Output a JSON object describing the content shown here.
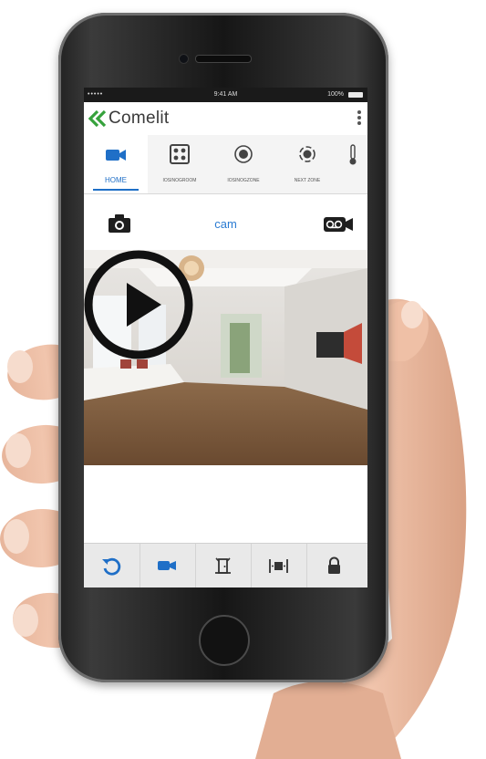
{
  "status_bar": {
    "signal": "•••••",
    "time": "9:41 AM",
    "battery": "100%"
  },
  "app": {
    "brand": "Comelit"
  },
  "tabs": [
    {
      "label": "HOME",
      "icon": "camera-icon",
      "active": true
    },
    {
      "label": "IOSINOGROOM",
      "icon": "grid-icon",
      "active": false
    },
    {
      "label": "IOSINOGZONE",
      "icon": "target-icon",
      "active": false
    },
    {
      "label": "NEXT ZONE",
      "icon": "crosshair-icon",
      "active": false
    },
    {
      "label": "",
      "icon": "thermometer-icon",
      "active": false
    }
  ],
  "camera": {
    "name": "cam",
    "snapshot_icon": "camera-snapshot-icon",
    "record_icon": "voicemail-record-icon"
  },
  "video": {
    "play_icon": "play-icon"
  },
  "below_text": "",
  "toolbar": [
    {
      "icon": "refresh-icon"
    },
    {
      "icon": "video-camera-icon"
    },
    {
      "icon": "door-icon"
    },
    {
      "icon": "gate-icon"
    },
    {
      "icon": "lock-icon"
    }
  ],
  "colors": {
    "accent": "#1f6fc7",
    "brand_green": "#36a23c",
    "toolbar": "#e9e9e9"
  }
}
